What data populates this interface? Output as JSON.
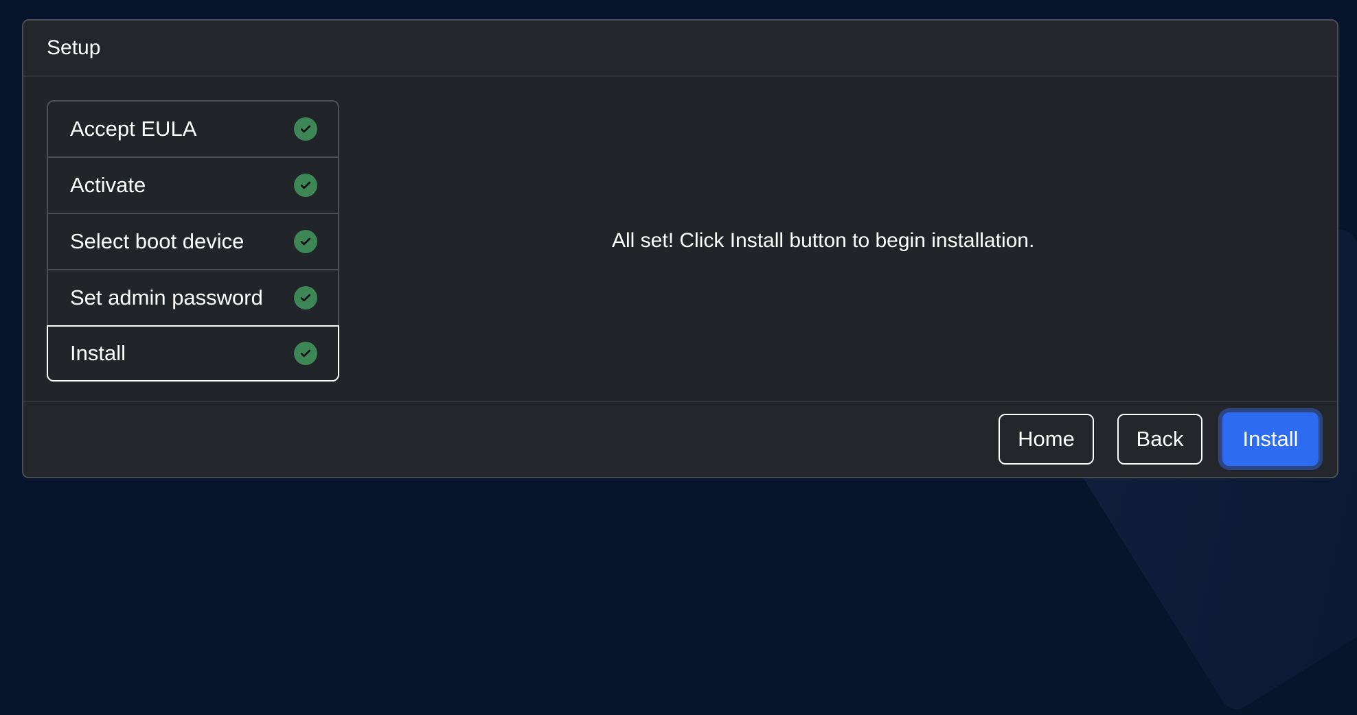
{
  "card": {
    "title": "Setup"
  },
  "steps": [
    {
      "label": "Accept EULA",
      "completed": true,
      "active": false
    },
    {
      "label": "Activate",
      "completed": true,
      "active": false
    },
    {
      "label": "Select boot device",
      "completed": true,
      "active": false
    },
    {
      "label": "Set admin password",
      "completed": true,
      "active": false
    },
    {
      "label": "Install",
      "completed": true,
      "active": true
    }
  ],
  "message": {
    "text": "All set! Click Install button to begin installation."
  },
  "footer": {
    "home_label": "Home",
    "back_label": "Back",
    "install_label": "Install"
  },
  "colors": {
    "page_background": "#08132c",
    "card_background": "#212529",
    "check_green": "#3d8656",
    "primary_blue": "#2d6cf1"
  },
  "icons": {
    "completed_step": "check-circle-icon"
  }
}
